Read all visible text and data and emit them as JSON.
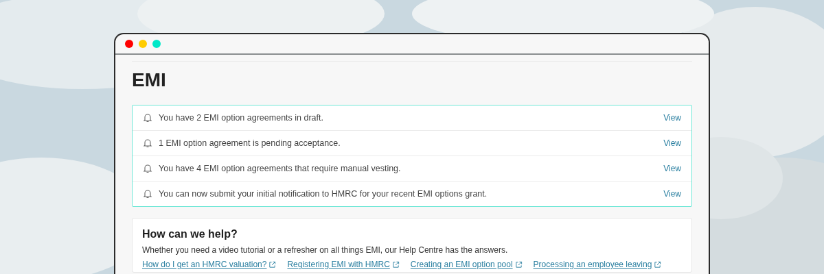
{
  "window": {
    "title": "EMI"
  },
  "notifications": [
    {
      "text": "You have 2 EMI option agreements in draft.",
      "action": "View"
    },
    {
      "text": "1 EMI option agreement is pending acceptance.",
      "action": "View"
    },
    {
      "text": "You have 4 EMI option agreements that require manual vesting.",
      "action": "View"
    },
    {
      "text": "You can now submit your initial notification to HMRC for your recent EMI options grant.",
      "action": "View"
    }
  ],
  "help": {
    "title": "How can we help?",
    "text": "Whether you need a video tutorial or a refresher on all things EMI, our Help Centre has the answers.",
    "links": [
      "How do I get an HMRC valuation?",
      "Registering EMI with HMRC",
      "Creating an EMI option pool",
      "Processing an employee leaving"
    ]
  }
}
